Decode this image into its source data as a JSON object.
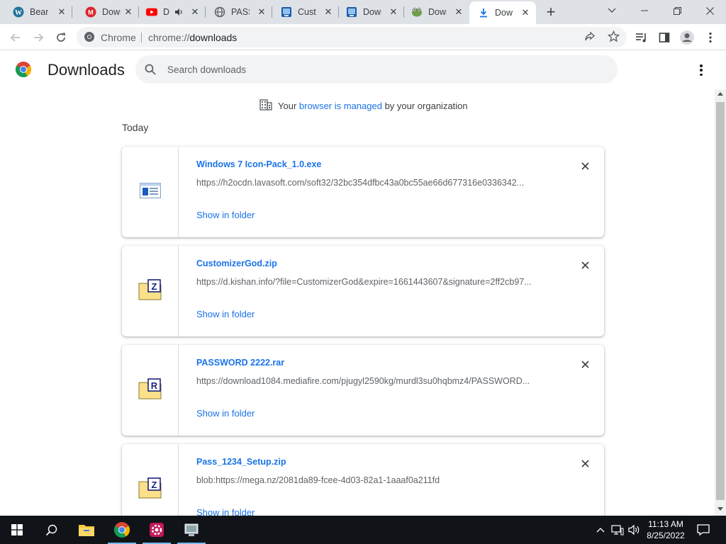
{
  "browser": {
    "tabs": [
      {
        "label": "Beam",
        "icon": "wordpress-icon"
      },
      {
        "label": "Down",
        "icon": "mega-icon"
      },
      {
        "label": "D",
        "icon": "youtube-icon"
      },
      {
        "label": "PASS",
        "icon": "globe-icon"
      },
      {
        "label": "Custo",
        "icon": "customizer-icon"
      },
      {
        "label": "Down",
        "icon": "customizer-icon"
      },
      {
        "label": "Down",
        "icon": "frog-icon"
      },
      {
        "label": "Dow",
        "icon": "download-icon"
      }
    ],
    "active_tab_index": 7,
    "omnibox": {
      "site_label": "Chrome",
      "url_scheme": "chrome://",
      "url_path": "downloads"
    }
  },
  "page": {
    "title": "Downloads",
    "search_placeholder": "Search downloads",
    "managed_prefix": "Your ",
    "managed_link": "browser is managed",
    "managed_suffix": " by your organization",
    "date_heading": "Today"
  },
  "downloads": [
    {
      "filename": "Windows 7 Icon-Pack_1.0.exe",
      "url": "https://h2ocdn.lavasoft.com/soft32/32bc354dfbc43a0bc55ae66d677316e0336342...",
      "action": "Show in folder",
      "file_icon": "exe-icon"
    },
    {
      "filename": "CustomizerGod.zip",
      "url": "https://d.kishan.info/?file=CustomizerGod&expire=1661443607&signature=2ff2cb97...",
      "action": "Show in folder",
      "file_icon": "zip-archive-icon"
    },
    {
      "filename": "PASSWORD 2222.rar",
      "url": "https://download1084.mediafire.com/pjugyl2590kg/murdl3su0hqbmz4/PASSWORD...",
      "action": "Show in folder",
      "file_icon": "rar-archive-icon"
    },
    {
      "filename": "Pass_1234_Setup.zip",
      "url": "blob:https://mega.nz/2081da89-fcee-4d03-82a1-1aaaf0a211fd",
      "action": "Show in folder",
      "file_icon": "zip-archive-icon"
    }
  ],
  "taskbar": {
    "time": "11:13 AM",
    "date": "8/25/2022"
  },
  "colors": {
    "link": "#1a73e8",
    "tabstrip": "#dee1e6",
    "taskbar": "#101418"
  }
}
